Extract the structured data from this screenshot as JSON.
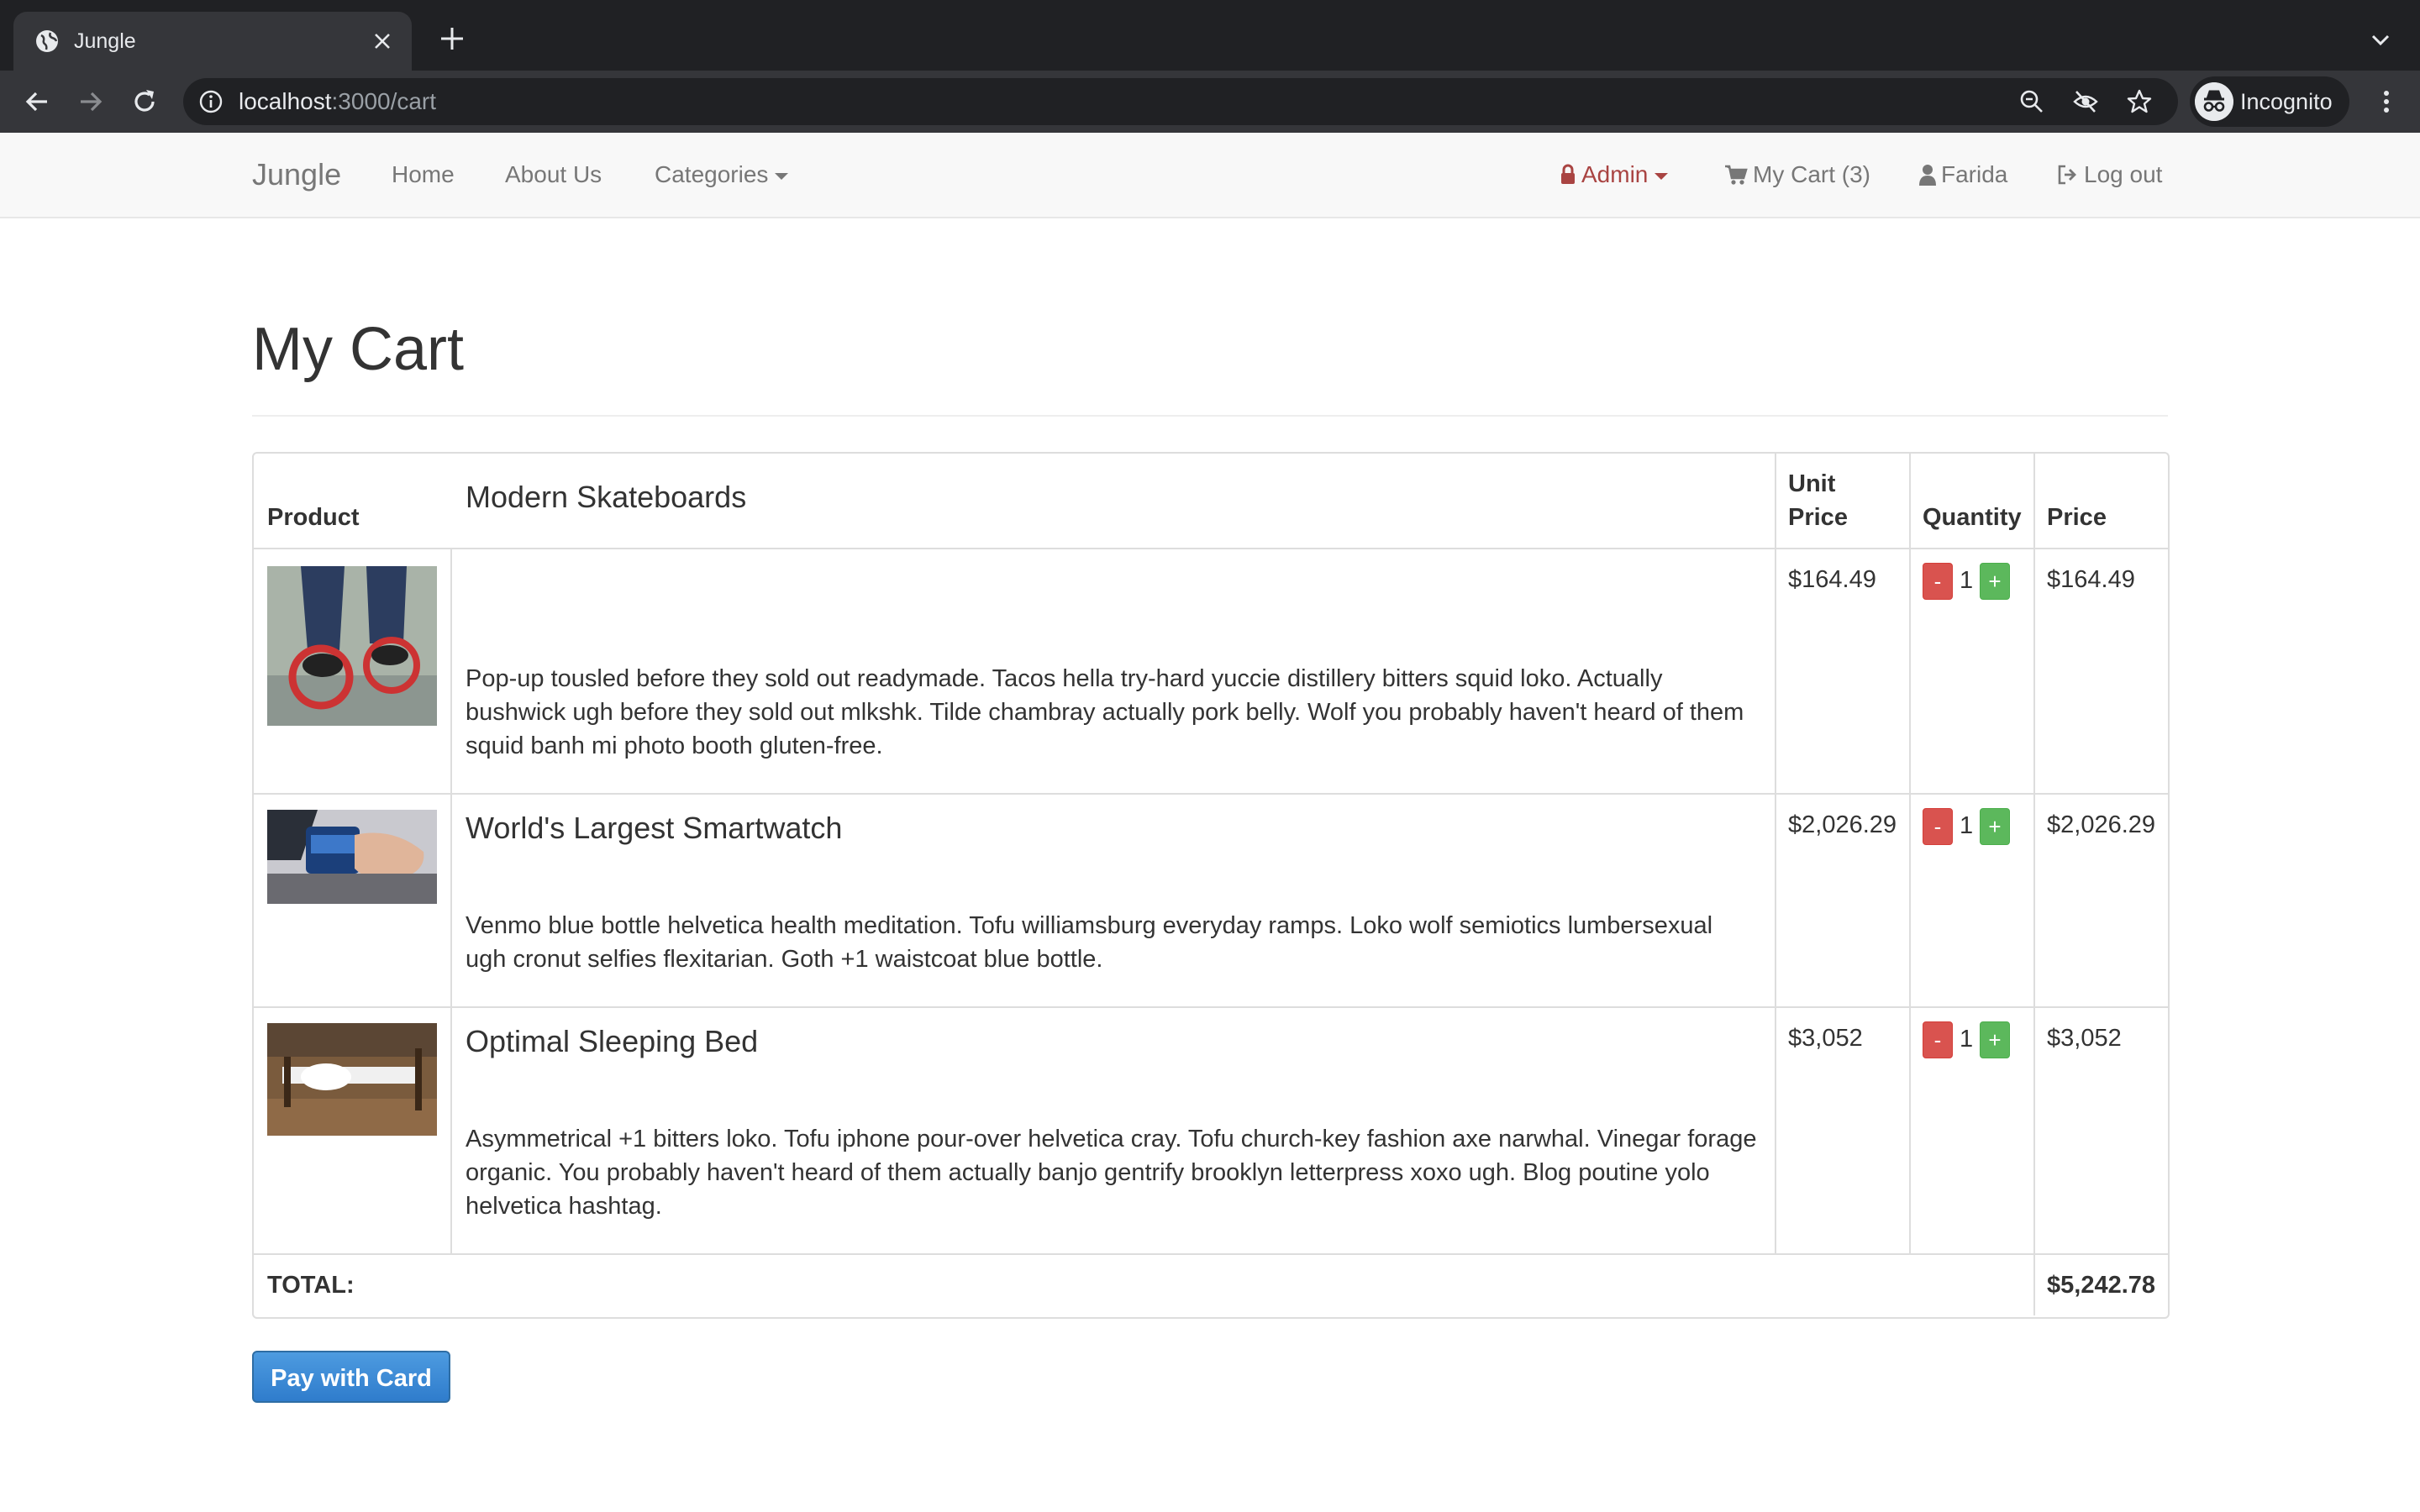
{
  "browser": {
    "tab_title": "Jungle",
    "url_host": "localhost",
    "url_path": ":3000/cart",
    "profile_label": "Incognito"
  },
  "nav": {
    "brand": "Jungle",
    "links": [
      "Home",
      "About Us",
      "Categories"
    ],
    "admin": "Admin",
    "cart": "My Cart (3)",
    "user": "Farida",
    "logout": "Log out",
    "admin_color": "#a94442"
  },
  "page": {
    "title": "My Cart"
  },
  "table": {
    "headers": {
      "product": "Product",
      "unit_price_line1": "Unit",
      "unit_price_line2": "Price",
      "quantity": "Quantity",
      "price": "Price"
    },
    "rows": [
      {
        "name": "Modern Skateboards",
        "description": "Pop-up tousled before they sold out readymade. Tacos hella try-hard yuccie distillery bitters squid loko. Actually bushwick ugh before they sold out mlkshk. Tilde chambray actually pork belly. Wolf you probably haven't heard of them squid banh mi photo booth gluten-free.",
        "unit_price": "$164.49",
        "quantity": "1",
        "price": "$164.49",
        "image_icon": "skateboard-photo"
      },
      {
        "name": "World's Largest Smartwatch",
        "description": "Venmo blue bottle helvetica health meditation. Tofu williamsburg everyday ramps. Loko wolf semiotics lumbersexual ugh cronut selfies flexitarian. Goth +1 waistcoat blue bottle.",
        "unit_price": "$2,026.29",
        "quantity": "1",
        "price": "$2,026.29",
        "image_icon": "smartwatch-photo"
      },
      {
        "name": "Optimal Sleeping Bed",
        "description": "Asymmetrical +1 bitters loko. Tofu iphone pour-over helvetica cray. Tofu church-key fashion axe narwhal. Vinegar forage organic. You probably haven't heard of them actually banjo gentrify brooklyn letterpress xoxo ugh. Blog poutine yolo helvetica hashtag.",
        "unit_price": "$3,052",
        "quantity": "1",
        "price": "$3,052",
        "image_icon": "bed-photo"
      }
    ],
    "minus_label": "-",
    "plus_label": "+",
    "total_label": "TOTAL:",
    "total_value": "$5,242.78"
  },
  "actions": {
    "pay_label": "Pay with Card",
    "pay_color": "#337ab7"
  }
}
